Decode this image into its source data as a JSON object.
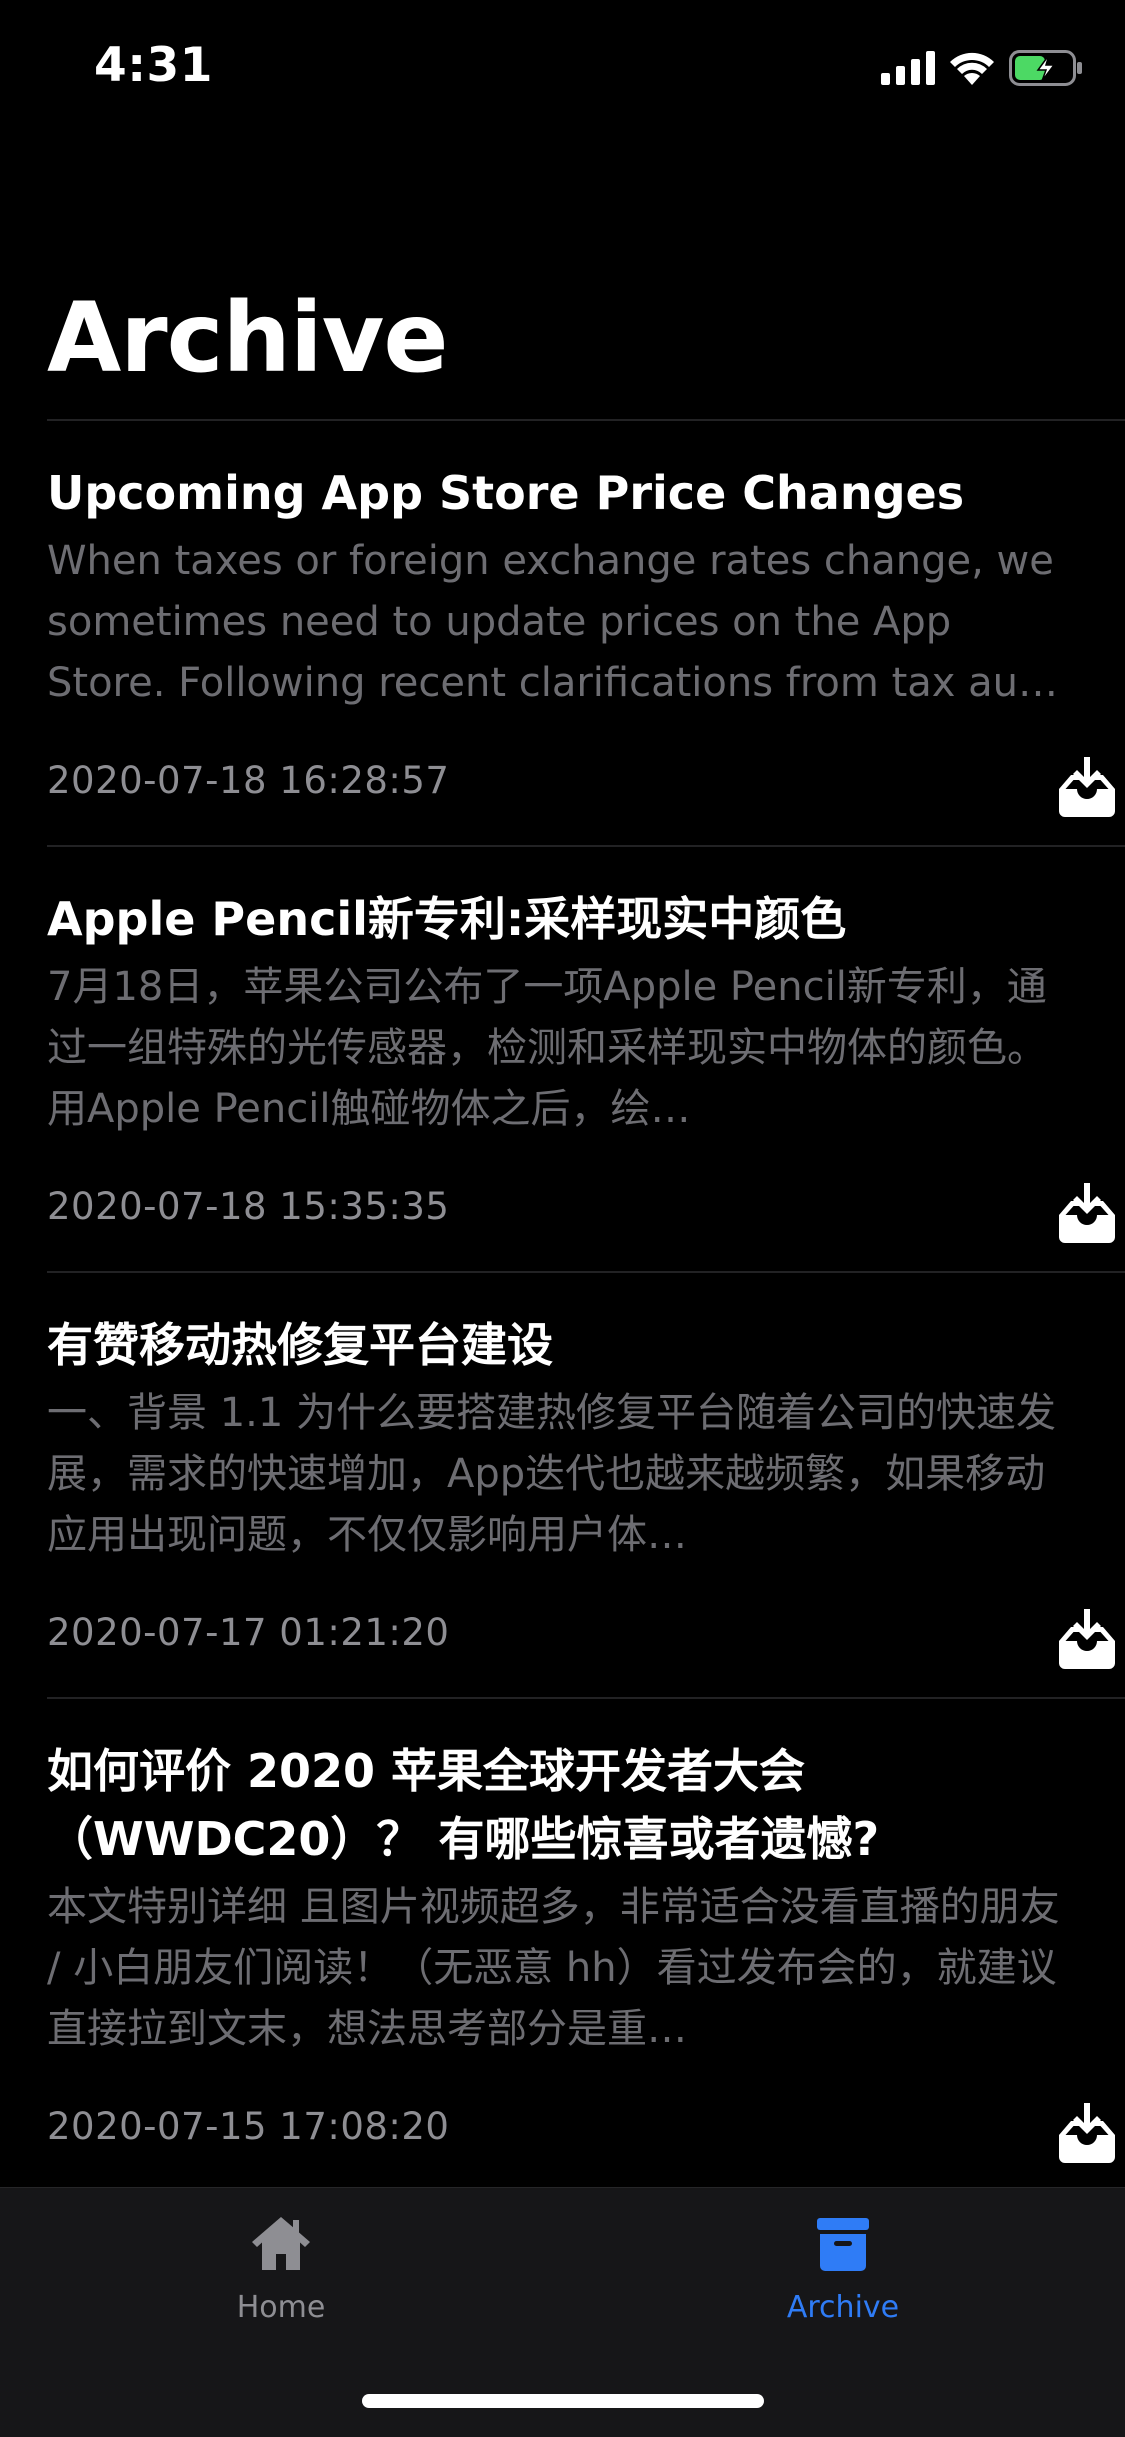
{
  "status_bar": {
    "time": "4:31"
  },
  "header": {
    "title": "Archive"
  },
  "articles": [
    {
      "title": "Upcoming App Store Price Changes",
      "summary": "When taxes or foreign exchange rates change, we sometimes need to update prices on the App Store. Following recent clarifications from tax au…",
      "date": "2020-07-18 16:28:57"
    },
    {
      "title": "Apple Pencil新专利:采样现实中颜色",
      "summary": "7月18日，苹果公司公布了一项Apple Pencil新专利，通过一组特殊的光传感器，检测和采样现实中物体的颜色。用Apple Pencil触碰物体之后，绘…",
      "date": "2020-07-18 15:35:35"
    },
    {
      "title": "有赞移动热修复平台建设",
      "summary": "一、背景 1.1 为什么要搭建热修复平台随着公司的快速发展，需求的快速增加，App迭代也越来越频繁，如果移动应用出现问题，不仅仅影响用户体…",
      "date": "2020-07-17 01:21:20"
    },
    {
      "title": "如何评价 2020 苹果全球开发者大会（WWDC20）？ 有哪些惊喜或者遗憾?",
      "summary": "本文特别详细 且图片视频超多，非常适合没看直播的朋友 / 小白朋友们阅读！（无恶意 hh）看过发布会的，就建议直接拉到文末，想法思考部分是重…",
      "date": "2020-07-15 17:08:20"
    }
  ],
  "tab_bar": {
    "tabs": [
      {
        "label": "Home",
        "icon": "house-icon",
        "selected": false
      },
      {
        "label": "Archive",
        "icon": "archivebox-icon",
        "selected": true
      }
    ]
  },
  "colors": {
    "background": "#000000",
    "summary_text": "#6d6d72",
    "accent": "#2f7cf6",
    "tab_bar_bg": "#161618",
    "battery_charging": "#4cd964"
  }
}
